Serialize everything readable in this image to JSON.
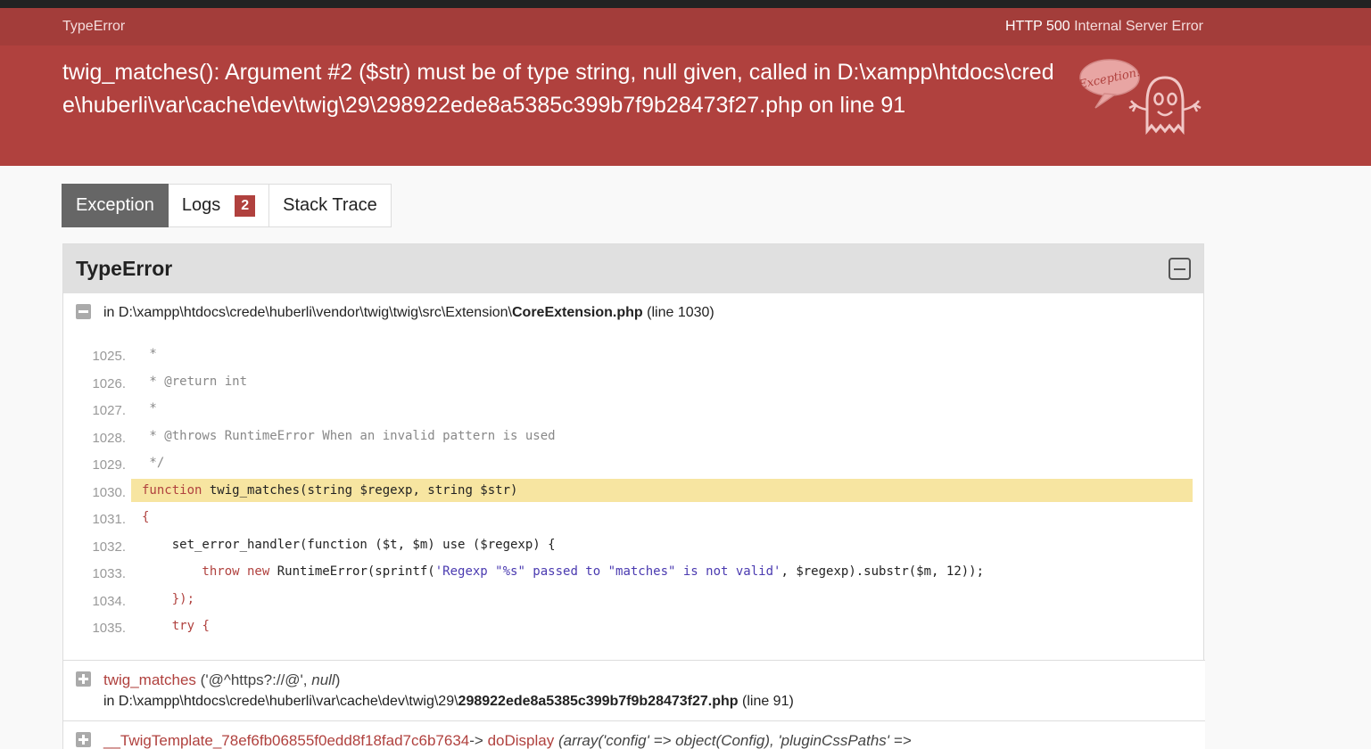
{
  "header": {
    "exception_class": "TypeError",
    "http_status_code": "HTTP 500",
    "http_status_text": "Internal Server Error",
    "message": "twig_matches(): Argument #2 ($str) must be of type string, null given, called in D:\\xampp\\htdocs\\crede\\huberli\\var\\cache\\dev\\twig\\29\\298922ede8a5385c399b7f9b28473f27.php on line 91",
    "ghost_label": "Exception!"
  },
  "tabs": [
    {
      "label": "Exception"
    },
    {
      "label": "Logs",
      "badge": "2"
    },
    {
      "label": "Stack Trace"
    }
  ],
  "panel": {
    "title": "TypeError",
    "file_prefix": "in D:\\xampp\\htdocs\\crede\\huberli\\vendor\\twig\\twig\\src\\Extension\\",
    "file_name": "CoreExtension.php",
    "file_suffix": "(line 1030)"
  },
  "code_lines": [
    {
      "num": "1025.",
      "text": " *"
    },
    {
      "num": "1026.",
      "text": " * @return int"
    },
    {
      "num": "1027.",
      "text": " *"
    },
    {
      "num": "1028.",
      "text": " * @throws RuntimeError When an invalid pattern is used"
    },
    {
      "num": "1029.",
      "text": " */"
    },
    {
      "num": "1030.",
      "kw": "function",
      "text": " twig_matches(string $regexp, string $str)"
    },
    {
      "num": "1031.",
      "text": "{"
    },
    {
      "num": "1032.",
      "text": "    set_error_handler(function ($t, $m) use ($regexp) {"
    },
    {
      "num": "1033.",
      "kw": "        throw new",
      "text": " RuntimeError(sprintf(",
      "str": "'Regexp \"%s\" passed to \"matches\" is not valid'",
      "tail": ", $regexp).substr($m, 12));"
    },
    {
      "num": "1034.",
      "text": "    });"
    },
    {
      "num": "1035.",
      "kw": "    try",
      "text": " {"
    }
  ],
  "trace": [
    {
      "fn": "twig_matches",
      "args_a": "('@^https?://@', ",
      "args_b": "null",
      "args_c": ")",
      "file_prefix": "in D:\\xampp\\htdocs\\crede\\huberli\\var\\cache\\dev\\twig\\29\\",
      "file_name": "298922ede8a5385c399b7f9b28473f27.php",
      "file_suffix": "(line 91)"
    },
    {
      "class": "__TwigTemplate_78ef6fb06855f0edd8f18fad7c6b7634",
      "arrow": "->",
      "method": "doDisplay",
      "args": "(array('config' => object(Config), 'pluginCssPaths' =>"
    }
  ]
}
